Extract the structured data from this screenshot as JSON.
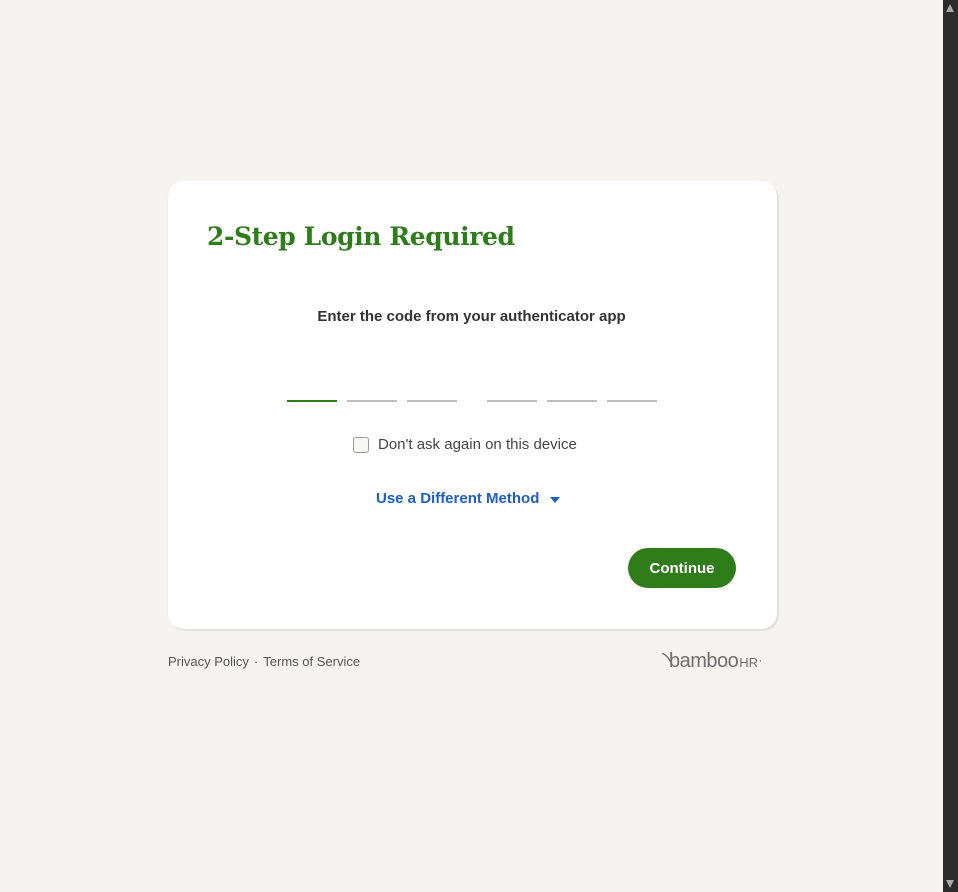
{
  "card": {
    "title": "2-Step Login Required",
    "instruction": "Enter the code from your authenticator app",
    "code_digits": [
      "",
      "",
      "",
      "",
      "",
      ""
    ],
    "remember_label": "Don't ask again on this device",
    "remember_checked": false,
    "method_link_label": "Use a Different Method",
    "continue_label": "Continue"
  },
  "footer": {
    "privacy_label": "Privacy Policy",
    "separator": "·",
    "terms_label": "Terms of Service"
  },
  "logo": {
    "word": "bamboo",
    "suffix": "HR",
    "mark": "’"
  },
  "colors": {
    "brand_green": "#2e7d1a",
    "link_blue": "#1e5fc0",
    "page_background": "#f5f4f1",
    "card_background": "#ffffff"
  },
  "icons": {
    "method_link": "caret-down-icon",
    "logo": "bamboo-leaf-icon"
  }
}
